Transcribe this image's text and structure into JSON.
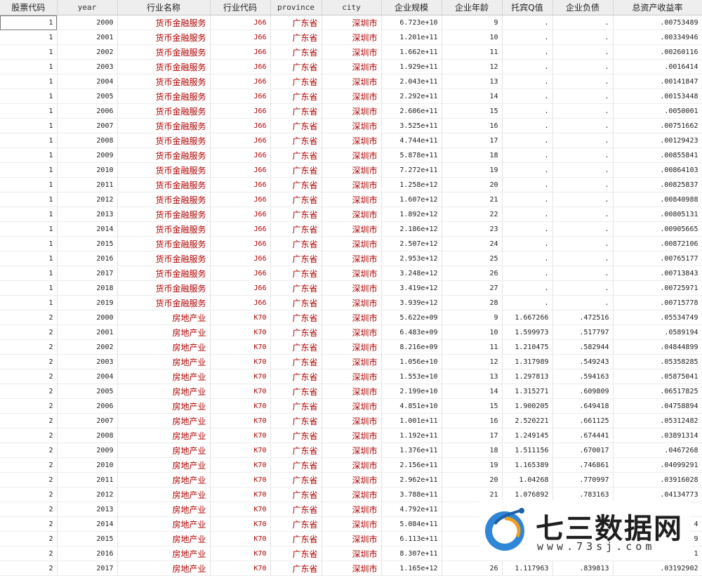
{
  "columns": [
    "股票代码",
    "year",
    "行业名称",
    "行业代码",
    "province",
    "city",
    "企业规模",
    "企业年龄",
    "托宾Q值",
    "企业负债",
    "总资产收益率"
  ],
  "rows": [
    [
      "1",
      "2000",
      "货币金融服务",
      "J66",
      "广东省",
      "深圳市",
      "6.723e+10",
      "9",
      ".",
      ".",
      ".00753489"
    ],
    [
      "1",
      "2001",
      "货币金融服务",
      "J66",
      "广东省",
      "深圳市",
      "1.201e+11",
      "10",
      ".",
      ".",
      ".00334946"
    ],
    [
      "1",
      "2002",
      "货币金融服务",
      "J66",
      "广东省",
      "深圳市",
      "1.662e+11",
      "11",
      ".",
      ".",
      ".00260116"
    ],
    [
      "1",
      "2003",
      "货币金融服务",
      "J66",
      "广东省",
      "深圳市",
      "1.929e+11",
      "12",
      ".",
      ".",
      ".0016414"
    ],
    [
      "1",
      "2004",
      "货币金融服务",
      "J66",
      "广东省",
      "深圳市",
      "2.043e+11",
      "13",
      ".",
      ".",
      ".00141847"
    ],
    [
      "1",
      "2005",
      "货币金融服务",
      "J66",
      "广东省",
      "深圳市",
      "2.292e+11",
      "14",
      ".",
      ".",
      ".00153448"
    ],
    [
      "1",
      "2006",
      "货币金融服务",
      "J66",
      "广东省",
      "深圳市",
      "2.606e+11",
      "15",
      ".",
      ".",
      ".0050001"
    ],
    [
      "1",
      "2007",
      "货币金融服务",
      "J66",
      "广东省",
      "深圳市",
      "3.525e+11",
      "16",
      ".",
      ".",
      ".00751662"
    ],
    [
      "1",
      "2008",
      "货币金融服务",
      "J66",
      "广东省",
      "深圳市",
      "4.744e+11",
      "17",
      ".",
      ".",
      ".00129423"
    ],
    [
      "1",
      "2009",
      "货币金融服务",
      "J66",
      "广东省",
      "深圳市",
      "5.878e+11",
      "18",
      ".",
      ".",
      ".00855841"
    ],
    [
      "1",
      "2010",
      "货币金融服务",
      "J66",
      "广东省",
      "深圳市",
      "7.272e+11",
      "19",
      ".",
      ".",
      ".00864103"
    ],
    [
      "1",
      "2011",
      "货币金融服务",
      "J66",
      "广东省",
      "深圳市",
      "1.258e+12",
      "20",
      ".",
      ".",
      ".00825837"
    ],
    [
      "1",
      "2012",
      "货币金融服务",
      "J66",
      "广东省",
      "深圳市",
      "1.607e+12",
      "21",
      ".",
      ".",
      ".00840988"
    ],
    [
      "1",
      "2013",
      "货币金融服务",
      "J66",
      "广东省",
      "深圳市",
      "1.892e+12",
      "22",
      ".",
      ".",
      ".00805131"
    ],
    [
      "1",
      "2014",
      "货币金融服务",
      "J66",
      "广东省",
      "深圳市",
      "2.186e+12",
      "23",
      ".",
      ".",
      ".00905665"
    ],
    [
      "1",
      "2015",
      "货币金融服务",
      "J66",
      "广东省",
      "深圳市",
      "2.507e+12",
      "24",
      ".",
      ".",
      ".00872106"
    ],
    [
      "1",
      "2016",
      "货币金融服务",
      "J66",
      "广东省",
      "深圳市",
      "2.953e+12",
      "25",
      ".",
      ".",
      ".00765177"
    ],
    [
      "1",
      "2017",
      "货币金融服务",
      "J66",
      "广东省",
      "深圳市",
      "3.248e+12",
      "26",
      ".",
      ".",
      ".00713843"
    ],
    [
      "1",
      "2018",
      "货币金融服务",
      "J66",
      "广东省",
      "深圳市",
      "3.419e+12",
      "27",
      ".",
      ".",
      ".00725971"
    ],
    [
      "1",
      "2019",
      "货币金融服务",
      "J66",
      "广东省",
      "深圳市",
      "3.939e+12",
      "28",
      ".",
      ".",
      ".00715778"
    ],
    [
      "2",
      "2000",
      "房地产业",
      "K70",
      "广东省",
      "深圳市",
      "5.622e+09",
      "9",
      "1.667266",
      ".472516",
      ".05534749"
    ],
    [
      "2",
      "2001",
      "房地产业",
      "K70",
      "广东省",
      "深圳市",
      "6.483e+09",
      "10",
      "1.599973",
      ".517797",
      ".0589194"
    ],
    [
      "2",
      "2002",
      "房地产业",
      "K70",
      "广东省",
      "深圳市",
      "8.216e+09",
      "11",
      "1.210475",
      ".582944",
      ".04844899"
    ],
    [
      "2",
      "2003",
      "房地产业",
      "K70",
      "广东省",
      "深圳市",
      "1.056e+10",
      "12",
      "1.317989",
      ".549243",
      ".05358285"
    ],
    [
      "2",
      "2004",
      "房地产业",
      "K70",
      "广东省",
      "深圳市",
      "1.553e+10",
      "13",
      "1.297813",
      ".594163",
      ".05875041"
    ],
    [
      "2",
      "2005",
      "房地产业",
      "K70",
      "广东省",
      "深圳市",
      "2.199e+10",
      "14",
      "1.315271",
      ".609809",
      ".06517825"
    ],
    [
      "2",
      "2006",
      "房地产业",
      "K70",
      "广东省",
      "深圳市",
      "4.851e+10",
      "15",
      "1.900205",
      ".649418",
      ".04758894"
    ],
    [
      "2",
      "2007",
      "房地产业",
      "K70",
      "广东省",
      "深圳市",
      "1.001e+11",
      "16",
      "2.520221",
      ".661125",
      ".05312482"
    ],
    [
      "2",
      "2008",
      "房地产业",
      "K70",
      "广东省",
      "深圳市",
      "1.192e+11",
      "17",
      "1.249145",
      ".674441",
      ".03891314"
    ],
    [
      "2",
      "2009",
      "房地产业",
      "K70",
      "广东省",
      "深圳市",
      "1.376e+11",
      "18",
      "1.511156",
      ".670017",
      ".0467268"
    ],
    [
      "2",
      "2010",
      "房地产业",
      "K70",
      "广东省",
      "深圳市",
      "2.156e+11",
      "19",
      "1.165389",
      ".746861",
      ".04099291"
    ],
    [
      "2",
      "2011",
      "房地产业",
      "K70",
      "广东省",
      "深圳市",
      "2.962e+11",
      "20",
      "1.04268",
      ".770997",
      ".03916028"
    ],
    [
      "2",
      "2012",
      "房地产业",
      "K70",
      "广东省",
      "深圳市",
      "3.788e+11",
      "21",
      "1.076892",
      ".783163",
      ".04134773"
    ],
    [
      "2",
      "2013",
      "房地产业",
      "K70",
      "广东省",
      "深圳市",
      "4.792e+11",
      "",
      "",
      "",
      ""
    ],
    [
      "2",
      "2014",
      "房地产业",
      "K70",
      "广东省",
      "深圳市",
      "5.084e+11",
      "",
      "",
      "",
      "4"
    ],
    [
      "2",
      "2015",
      "房地产业",
      "K70",
      "广东省",
      "深圳市",
      "6.113e+11",
      "",
      "",
      "",
      "9"
    ],
    [
      "2",
      "2016",
      "房地产业",
      "K70",
      "广东省",
      "深圳市",
      "8.307e+11",
      "",
      "",
      "",
      "1"
    ],
    [
      "2",
      "2017",
      "房地产业",
      "K70",
      "广东省",
      "深圳市",
      "1.165e+12",
      "26",
      "1.117963",
      ".839813",
      ".03192902"
    ]
  ],
  "watermark": {
    "title": "七三数据网",
    "url": "www.73sj.com"
  }
}
